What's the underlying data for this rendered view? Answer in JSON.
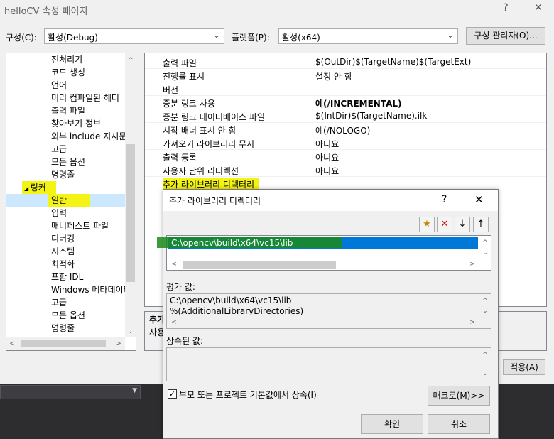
{
  "window": {
    "title": "helloCV 속성 페이지",
    "help_btn": "?",
    "close_btn": "✕"
  },
  "toolbar": {
    "config_label": "구성(C):",
    "config_value": "활성(Debug)",
    "platform_label": "플랫폼(P):",
    "platform_value": "활성(x64)",
    "config_manager_button": "구성 관리자(O)..."
  },
  "tree": {
    "items": [
      {
        "label": "전처리기"
      },
      {
        "label": "코드 생성"
      },
      {
        "label": "언어"
      },
      {
        "label": "미리 컴파일된 헤더"
      },
      {
        "label": "출력 파일"
      },
      {
        "label": "찾아보기 정보"
      },
      {
        "label": "외부 include 지시문"
      },
      {
        "label": "고급"
      },
      {
        "label": "모든 옵션"
      },
      {
        "label": "명령줄"
      }
    ],
    "linker_label": "링커",
    "linker_children": [
      {
        "label": "일반"
      },
      {
        "label": "입력"
      },
      {
        "label": "매니페스트 파일"
      },
      {
        "label": "디버깅"
      },
      {
        "label": "시스템"
      },
      {
        "label": "최적화"
      },
      {
        "label": "포함 IDL"
      },
      {
        "label": "Windows 메타데이터"
      },
      {
        "label": "고급"
      },
      {
        "label": "모든 옵션"
      },
      {
        "label": "명령줄"
      }
    ]
  },
  "properties": [
    {
      "key": "출력 파일",
      "value": "$(OutDir)$(TargetName)$(TargetExt)",
      "bold": false
    },
    {
      "key": "진행률 표시",
      "value": "설정 안 함",
      "bold": false
    },
    {
      "key": "버전",
      "value": "",
      "bold": false
    },
    {
      "key": "증분 링크 사용",
      "value": "예(/INCREMENTAL)",
      "bold": true
    },
    {
      "key": "증분 링크 데이터베이스 파일",
      "value": "$(IntDir)$(TargetName).ilk",
      "bold": false
    },
    {
      "key": "시작 배너 표시 안 함",
      "value": "예(/NOLOGO)",
      "bold": false
    },
    {
      "key": "가져오기 라이브러리 무시",
      "value": "아니요",
      "bold": false
    },
    {
      "key": "출력 등록",
      "value": "아니요",
      "bold": false
    },
    {
      "key": "사용자 단위 리디렉션",
      "value": "아니요",
      "bold": false
    },
    {
      "key": "추가 라이브러리 디렉터리",
      "value": "",
      "bold": false
    }
  ],
  "description": {
    "title": "추가",
    "text": "사용"
  },
  "apply_button": "적용(A)",
  "dialog": {
    "title": "추가 라이브러리 디렉터리",
    "help_btn": "?",
    "close_btn": "✕",
    "entry": "C:\\opencv\\build\\x64\\vc15\\lib",
    "evaluated_label": "평가 값:",
    "evaluated_lines": [
      "C:\\opencv\\build\\x64\\vc15\\lib",
      "%(AdditionalLibraryDirectories)"
    ],
    "inherited_label": "상속된 값:",
    "inherit_checkbox": "부모 또는 프로젝트 기본값에서 상속(I)",
    "inherit_checked": true,
    "macro_button": "매크로(M)>>",
    "ok_button": "확인",
    "cancel_button": "취소"
  }
}
